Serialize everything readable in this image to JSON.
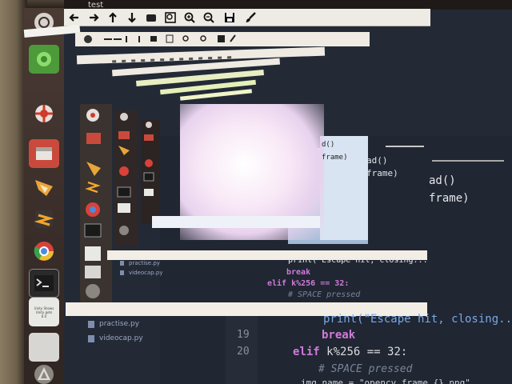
{
  "window": {
    "title": "test"
  },
  "toolbar": {
    "buttons": [
      {
        "name": "back-button",
        "icon": "arrow-left-icon"
      },
      {
        "name": "forward-button",
        "icon": "arrow-right-icon"
      },
      {
        "name": "up-button",
        "icon": "arrow-up-icon"
      },
      {
        "name": "down-button",
        "icon": "arrow-down-icon"
      },
      {
        "name": "box-button",
        "icon": "box-icon"
      },
      {
        "name": "zoom-region-button",
        "icon": "zoom-rect-icon"
      },
      {
        "name": "zoom-in-button",
        "icon": "zoom-in-icon"
      },
      {
        "name": "zoom-out-button",
        "icon": "zoom-out-icon"
      },
      {
        "name": "save-button",
        "icon": "save-icon"
      },
      {
        "name": "edit-button",
        "icon": "brush-icon"
      }
    ]
  },
  "launcher": {
    "items": [
      "ubuntu-logo-icon",
      "green-app-icon",
      "settings-icon",
      "files-icon",
      "blender-icon",
      "sublime-icon",
      "chrome-icon",
      "terminal-icon",
      "document-icon",
      "blank-icon",
      "update-icon"
    ],
    "note_text": "Unity Shows\nUnity gets\n6.0"
  },
  "files": {
    "items": [
      "practise.py",
      "videocap.py"
    ],
    "inner_items": [
      "practise.py",
      "videocap.py"
    ]
  },
  "editor": {
    "lines": [
      {
        "num": "19",
        "indent": "        ",
        "tokens": [
          {
            "t": "break",
            "c": "kw"
          }
        ]
      },
      {
        "num": "20",
        "indent": "    ",
        "tokens": [
          {
            "t": "elif ",
            "c": "kw"
          },
          {
            "t": "k%256 == 32:",
            "c": "txt"
          }
        ]
      },
      {
        "num": "",
        "indent": "        ",
        "tokens": [
          {
            "t": "# SPACE pressed",
            "c": "cm"
          }
        ]
      }
    ],
    "print_line": "print(\"Escape hit, closing...",
    "fragment_top": "ad()",
    "fragment_frame": "frame)",
    "fragment_small1": "d()",
    "fragment_small2": "frame)",
    "fragment_img_name": "img_name = \"opencv_frame_{}.png\"",
    "mid_lines": {
      "print": "print(\"Escape hit, closing...",
      "break": "break",
      "elif": "elif k%256 == 32:",
      "comment": "# SPACE pressed"
    }
  },
  "colors": {
    "editor_bg": "#202632",
    "keyword": "#d07adb",
    "comment": "#7b8598",
    "toolbar_bg": "#eeeae4"
  }
}
